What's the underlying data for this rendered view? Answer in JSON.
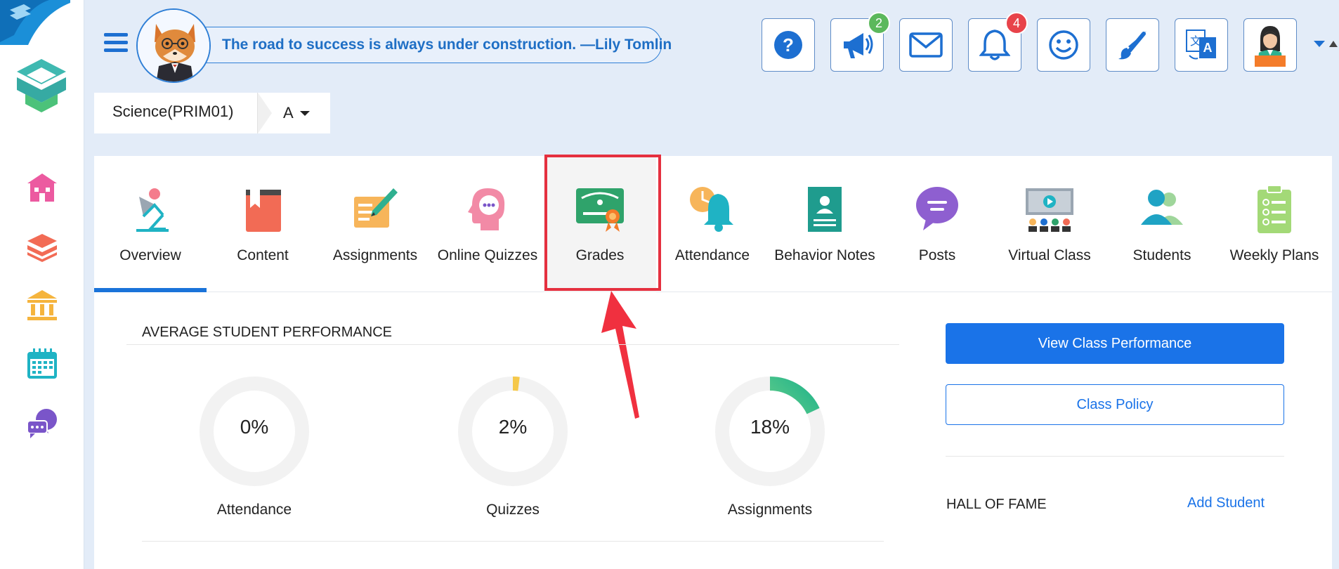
{
  "header": {
    "quote": "The road to success is always under construction. —Lily Tomlin",
    "buttons": [
      {
        "name": "help-button",
        "icon": "question-icon"
      },
      {
        "name": "announcements-button",
        "icon": "megaphone-icon",
        "badge": "2"
      },
      {
        "name": "messages-button",
        "icon": "envelope-icon"
      },
      {
        "name": "notifications-button",
        "icon": "bell-icon",
        "badge": "4"
      },
      {
        "name": "feedback-button",
        "icon": "smiley-icon"
      },
      {
        "name": "theme-button",
        "icon": "paintbrush-icon"
      },
      {
        "name": "language-button",
        "icon": "translate-icon"
      },
      {
        "name": "user-profile-button",
        "icon": "user-avatar-icon"
      }
    ]
  },
  "class_selector": {
    "class_name": "Science(PRIM01)",
    "section": "A"
  },
  "tabs": [
    {
      "label": "Overview",
      "icon": "overview-icon",
      "active": true
    },
    {
      "label": "Content",
      "icon": "book-icon"
    },
    {
      "label": "Assignments",
      "icon": "assignment-pen-icon"
    },
    {
      "label": "Online Quizzes",
      "icon": "quiz-head-icon"
    },
    {
      "label": "Grades",
      "icon": "certificate-icon",
      "highlighted": true
    },
    {
      "label": "Attendance",
      "icon": "clock-bell-icon"
    },
    {
      "label": "Behavior Notes",
      "icon": "id-card-icon"
    },
    {
      "label": "Posts",
      "icon": "speech-bubble-icon"
    },
    {
      "label": "Virtual Class",
      "icon": "video-class-icon"
    },
    {
      "label": "Students",
      "icon": "students-icon"
    },
    {
      "label": "Weekly Plans",
      "icon": "clipboard-icon"
    }
  ],
  "performance": {
    "title": "AVERAGE STUDENT PERFORMANCE",
    "metrics": [
      {
        "label": "Attendance",
        "percent_text": "0%",
        "value": 0
      },
      {
        "label": "Quizzes",
        "percent_text": "2%",
        "value": 2
      },
      {
        "label": "Assignments",
        "percent_text": "18%",
        "value": 18
      }
    ]
  },
  "actions": {
    "view_class_performance": "View Class Performance",
    "class_policy": "Class Policy"
  },
  "hall_of_fame": {
    "title": "HALL OF FAME",
    "add_student": "Add Student"
  },
  "colors": {
    "primary": "#1a73e8",
    "highlight": "#e5303f",
    "badge_green": "#5cb85c",
    "badge_red": "#e8434a"
  }
}
